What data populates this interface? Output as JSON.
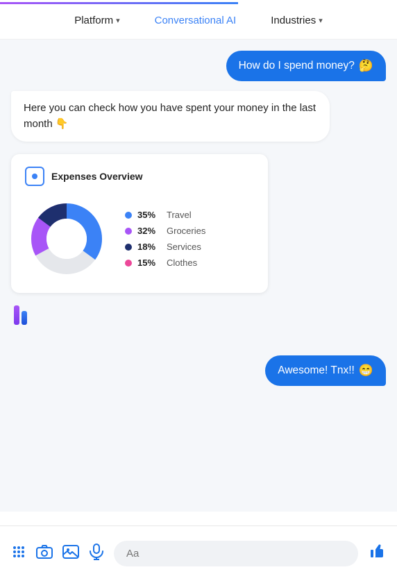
{
  "progress": {
    "width": "60%"
  },
  "nav": {
    "items": [
      {
        "id": "platform",
        "label": "Platform",
        "hasChevron": true
      },
      {
        "id": "conversational-ai",
        "label": "Conversational AI",
        "hasChevron": false
      },
      {
        "id": "industries",
        "label": "Industries",
        "hasChevron": true
      }
    ]
  },
  "chat": {
    "messages": [
      {
        "id": "msg1",
        "type": "user",
        "text": "How do I spend money?",
        "emoji": "🤔"
      },
      {
        "id": "msg2",
        "type": "bot",
        "text": "Here you can check how you have spent your money in the last month 👇"
      },
      {
        "id": "msg3",
        "type": "chart",
        "title": "Expenses Overview",
        "segments": [
          {
            "label": "Travel",
            "pct": 35,
            "color": "#3b82f6"
          },
          {
            "label": "Groceries",
            "pct": 32,
            "color": "#a855f7"
          },
          {
            "label": "Services",
            "pct": 18,
            "color": "#1e2f6e"
          },
          {
            "label": "Clothes",
            "pct": 15,
            "color": "#ec4899"
          }
        ]
      },
      {
        "id": "msg4",
        "type": "user",
        "text": "Awesome! Tnx!!",
        "emoji": "😁"
      }
    ]
  },
  "toolbar": {
    "placeholder": "Aa",
    "icons": {
      "grid": "⠿",
      "camera": "📷",
      "image": "🖼",
      "mic": "🎤",
      "thumb": "👍"
    }
  },
  "colors": {
    "user_bubble": "#1a73e8",
    "bot_bubble": "#ffffff",
    "travel": "#3b82f6",
    "groceries": "#a855f7",
    "services": "#1e2f6e",
    "clothes": "#ec4899"
  }
}
